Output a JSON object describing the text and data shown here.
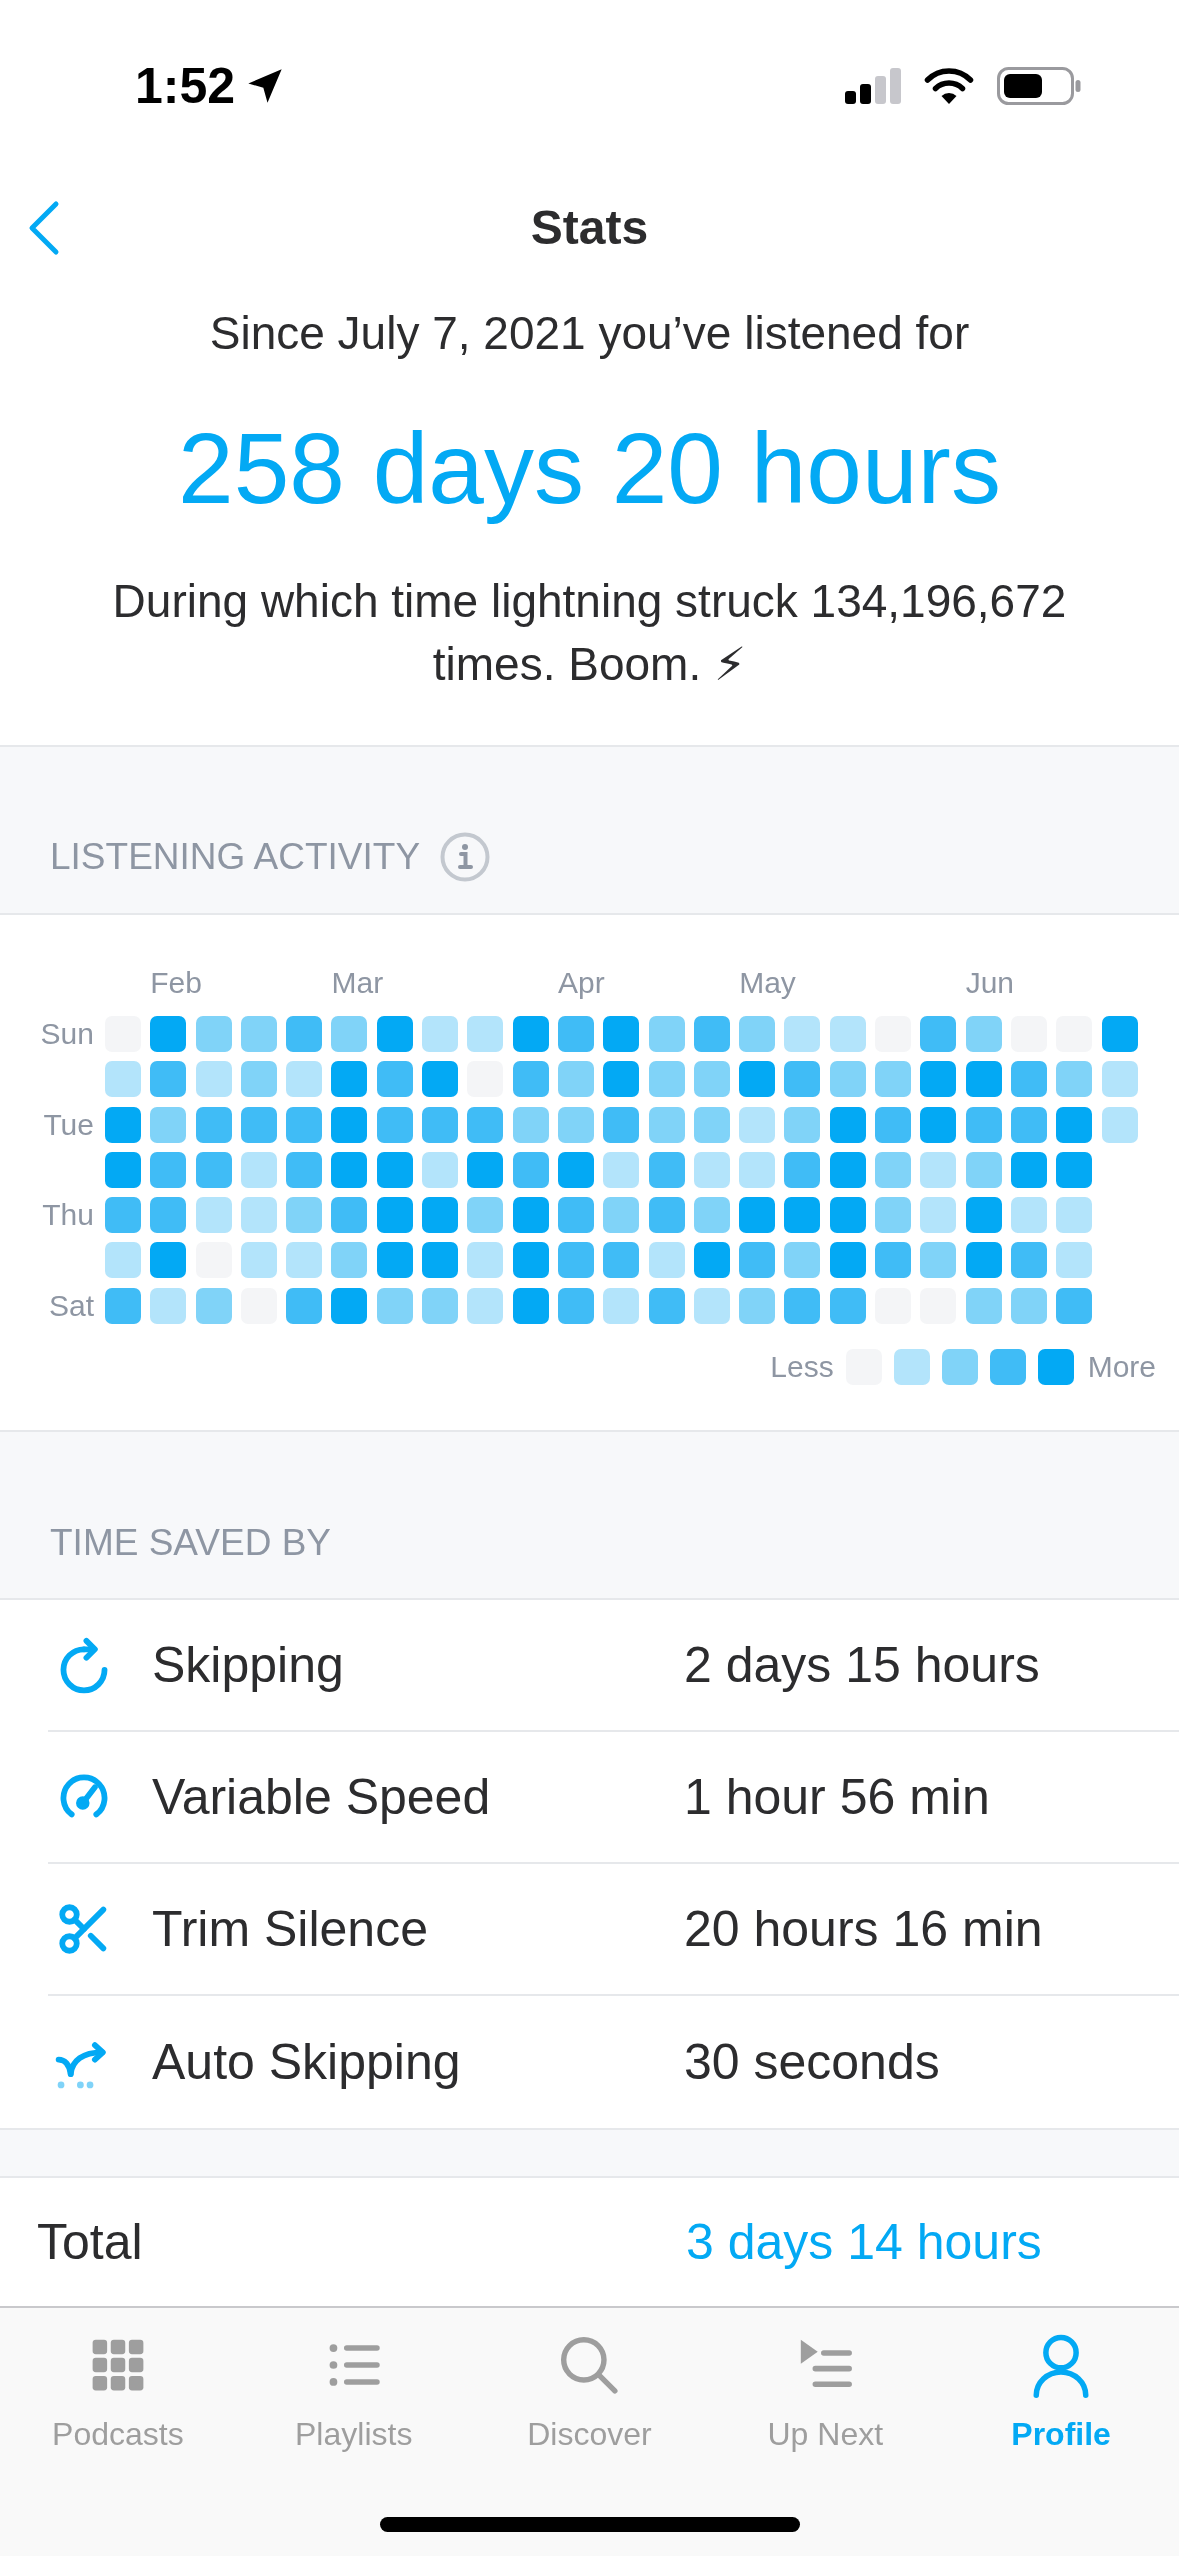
{
  "status_bar": {
    "time": "1:52"
  },
  "nav": {
    "title": "Stats"
  },
  "summary": {
    "intro": "Since July 7, 2021 you’ve listened for",
    "total": "258 days 20 hours",
    "fact": "During which time lightning struck 134,196,672 times. Boom. ⚡"
  },
  "activity": {
    "title": "LISTENING ACTIVITY",
    "day_labels": [
      "Sun",
      "Tue",
      "Thu",
      "Sat"
    ],
    "weeks": [
      {
        "days": [
          {
            "color": "#f4f5f7"
          },
          {
            "color": "#b3e4fb"
          },
          {
            "color": "#03a9f4"
          },
          {
            "color": "#03a9f4"
          },
          {
            "color": "#40bcf6"
          },
          {
            "color": "#b3e4fb"
          },
          {
            "color": "#40bcf6"
          }
        ]
      },
      {
        "month": "Feb",
        "days": [
          {
            "color": "#03a9f4"
          },
          {
            "color": "#40bcf6"
          },
          {
            "color": "#80d3f8"
          },
          {
            "color": "#40bcf6"
          },
          {
            "color": "#40bcf6"
          },
          {
            "color": "#03a9f4"
          },
          {
            "color": "#b3e4fb"
          }
        ]
      },
      {
        "days": [
          {
            "color": "#80d3f8"
          },
          {
            "color": "#b3e4fb"
          },
          {
            "color": "#40bcf6"
          },
          {
            "color": "#40bcf6"
          },
          {
            "color": "#b3e4fb"
          },
          {
            "color": "#f4f5f7"
          },
          {
            "color": "#80d3f8"
          }
        ]
      },
      {
        "days": [
          {
            "color": "#80d3f8"
          },
          {
            "color": "#80d3f8"
          },
          {
            "color": "#40bcf6"
          },
          {
            "color": "#b3e4fb"
          },
          {
            "color": "#b3e4fb"
          },
          {
            "color": "#b3e4fb"
          },
          {
            "color": "#f4f5f7"
          }
        ]
      },
      {
        "days": [
          {
            "color": "#40bcf6"
          },
          {
            "color": "#b3e4fb"
          },
          {
            "color": "#40bcf6"
          },
          {
            "color": "#40bcf6"
          },
          {
            "color": "#80d3f8"
          },
          {
            "color": "#b3e4fb"
          },
          {
            "color": "#40bcf6"
          }
        ]
      },
      {
        "month": "Mar",
        "days": [
          {
            "color": "#80d3f8"
          },
          {
            "color": "#03a9f4"
          },
          {
            "color": "#03a9f4"
          },
          {
            "color": "#03a9f4"
          },
          {
            "color": "#40bcf6"
          },
          {
            "color": "#80d3f8"
          },
          {
            "color": "#03a9f4"
          }
        ]
      },
      {
        "days": [
          {
            "color": "#03a9f4"
          },
          {
            "color": "#40bcf6"
          },
          {
            "color": "#40bcf6"
          },
          {
            "color": "#03a9f4"
          },
          {
            "color": "#03a9f4"
          },
          {
            "color": "#03a9f4"
          },
          {
            "color": "#80d3f8"
          }
        ]
      },
      {
        "days": [
          {
            "color": "#b3e4fb"
          },
          {
            "color": "#03a9f4"
          },
          {
            "color": "#40bcf6"
          },
          {
            "color": "#b3e4fb"
          },
          {
            "color": "#03a9f4"
          },
          {
            "color": "#03a9f4"
          },
          {
            "color": "#80d3f8"
          }
        ]
      },
      {
        "days": [
          {
            "color": "#b3e4fb"
          },
          {
            "color": "#f4f5f7"
          },
          {
            "color": "#40bcf6"
          },
          {
            "color": "#03a9f4"
          },
          {
            "color": "#80d3f8"
          },
          {
            "color": "#b3e4fb"
          },
          {
            "color": "#b3e4fb"
          }
        ]
      },
      {
        "days": [
          {
            "color": "#03a9f4"
          },
          {
            "color": "#40bcf6"
          },
          {
            "color": "#80d3f8"
          },
          {
            "color": "#40bcf6"
          },
          {
            "color": "#03a9f4"
          },
          {
            "color": "#03a9f4"
          },
          {
            "color": "#03a9f4"
          }
        ]
      },
      {
        "month": "Apr",
        "days": [
          {
            "color": "#40bcf6"
          },
          {
            "color": "#80d3f8"
          },
          {
            "color": "#80d3f8"
          },
          {
            "color": "#03a9f4"
          },
          {
            "color": "#40bcf6"
          },
          {
            "color": "#40bcf6"
          },
          {
            "color": "#40bcf6"
          }
        ]
      },
      {
        "days": [
          {
            "color": "#03a9f4"
          },
          {
            "color": "#03a9f4"
          },
          {
            "color": "#40bcf6"
          },
          {
            "color": "#b3e4fb"
          },
          {
            "color": "#80d3f8"
          },
          {
            "color": "#40bcf6"
          },
          {
            "color": "#b3e4fb"
          }
        ]
      },
      {
        "days": [
          {
            "color": "#80d3f8"
          },
          {
            "color": "#80d3f8"
          },
          {
            "color": "#80d3f8"
          },
          {
            "color": "#40bcf6"
          },
          {
            "color": "#40bcf6"
          },
          {
            "color": "#b3e4fb"
          },
          {
            "color": "#40bcf6"
          }
        ]
      },
      {
        "days": [
          {
            "color": "#40bcf6"
          },
          {
            "color": "#80d3f8"
          },
          {
            "color": "#80d3f8"
          },
          {
            "color": "#b3e4fb"
          },
          {
            "color": "#80d3f8"
          },
          {
            "color": "#03a9f4"
          },
          {
            "color": "#b3e4fb"
          }
        ]
      },
      {
        "month": "May",
        "days": [
          {
            "color": "#80d3f8"
          },
          {
            "color": "#03a9f4"
          },
          {
            "color": "#b3e4fb"
          },
          {
            "color": "#b3e4fb"
          },
          {
            "color": "#03a9f4"
          },
          {
            "color": "#40bcf6"
          },
          {
            "color": "#80d3f8"
          }
        ]
      },
      {
        "days": [
          {
            "color": "#b3e4fb"
          },
          {
            "color": "#40bcf6"
          },
          {
            "color": "#80d3f8"
          },
          {
            "color": "#40bcf6"
          },
          {
            "color": "#03a9f4"
          },
          {
            "color": "#80d3f8"
          },
          {
            "color": "#40bcf6"
          }
        ]
      },
      {
        "days": [
          {
            "color": "#b3e4fb"
          },
          {
            "color": "#80d3f8"
          },
          {
            "color": "#03a9f4"
          },
          {
            "color": "#03a9f4"
          },
          {
            "color": "#03a9f4"
          },
          {
            "color": "#03a9f4"
          },
          {
            "color": "#40bcf6"
          }
        ]
      },
      {
        "days": [
          {
            "color": "#f4f5f7"
          },
          {
            "color": "#80d3f8"
          },
          {
            "color": "#40bcf6"
          },
          {
            "color": "#80d3f8"
          },
          {
            "color": "#80d3f8"
          },
          {
            "color": "#40bcf6"
          },
          {
            "color": "#f4f5f7"
          }
        ]
      },
      {
        "days": [
          {
            "color": "#40bcf6"
          },
          {
            "color": "#03a9f4"
          },
          {
            "color": "#03a9f4"
          },
          {
            "color": "#b3e4fb"
          },
          {
            "color": "#b3e4fb"
          },
          {
            "color": "#80d3f8"
          },
          {
            "color": "#f4f5f7"
          }
        ]
      },
      {
        "month": "Jun",
        "days": [
          {
            "color": "#80d3f8"
          },
          {
            "color": "#03a9f4"
          },
          {
            "color": "#40bcf6"
          },
          {
            "color": "#80d3f8"
          },
          {
            "color": "#03a9f4"
          },
          {
            "color": "#03a9f4"
          },
          {
            "color": "#80d3f8"
          }
        ]
      },
      {
        "days": [
          {
            "color": "#f4f5f7"
          },
          {
            "color": "#40bcf6"
          },
          {
            "color": "#40bcf6"
          },
          {
            "color": "#03a9f4"
          },
          {
            "color": "#b3e4fb"
          },
          {
            "color": "#40bcf6"
          },
          {
            "color": "#80d3f8"
          }
        ]
      },
      {
        "days": [
          {
            "color": "#f4f5f7"
          },
          {
            "color": "#80d3f8"
          },
          {
            "color": "#03a9f4"
          },
          {
            "color": "#03a9f4"
          },
          {
            "color": "#b3e4fb"
          },
          {
            "color": "#b3e4fb"
          },
          {
            "color": "#40bcf6"
          }
        ]
      },
      {
        "days": [
          {
            "color": "#03a9f4"
          },
          {
            "color": "#b3e4fb"
          },
          {
            "color": "#b3e4fb"
          }
        ]
      }
    ],
    "legend": {
      "less": "Less",
      "more": "More",
      "swatches": [
        {
          "color": "#f4f5f7"
        },
        {
          "color": "#b3e4fb"
        },
        {
          "color": "#80d3f8"
        },
        {
          "color": "#40bcf6"
        },
        {
          "color": "#03a9f4"
        }
      ]
    }
  },
  "time_saved": {
    "title": "TIME SAVED BY",
    "rows": [
      {
        "label": "Skipping",
        "value": "2 days 15 hours"
      },
      {
        "label": "Variable Speed",
        "value": "1 hour 56 min"
      },
      {
        "label": "Trim Silence",
        "value": "20 hours 16 min"
      },
      {
        "label": "Auto Skipping",
        "value": "30 seconds"
      }
    ]
  },
  "total": {
    "label": "Total",
    "value": "3 days 14 hours"
  },
  "tab_bar": {
    "tabs": [
      {
        "label": "Podcasts",
        "selected": false
      },
      {
        "label": "Playlists",
        "selected": false
      },
      {
        "label": "Discover",
        "selected": false
      },
      {
        "label": "Up Next",
        "selected": false
      },
      {
        "label": "Profile",
        "selected": true
      }
    ]
  }
}
